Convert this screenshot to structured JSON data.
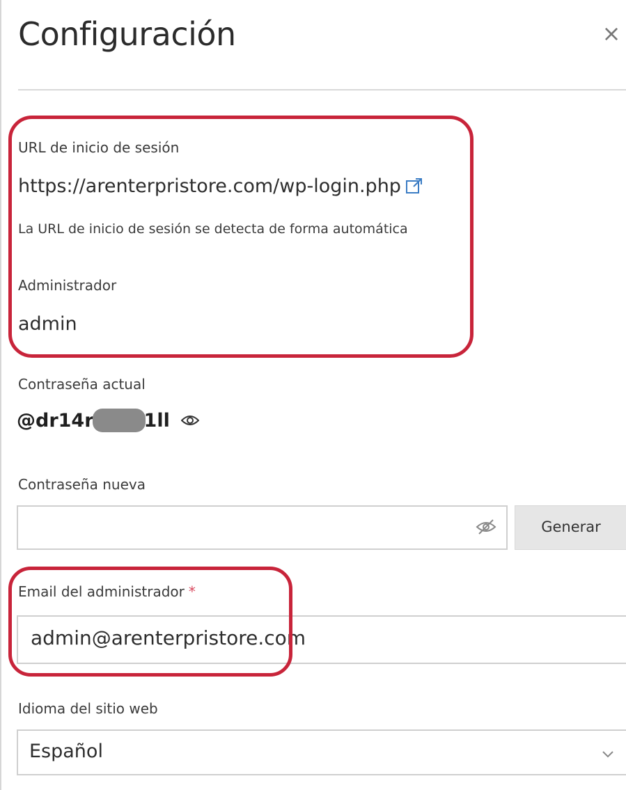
{
  "dialog": {
    "title": "Configuración",
    "close_label": "×"
  },
  "login_url": {
    "label": "URL de inicio de sesión",
    "value": "https://arenterpristore.com/wp-login.php",
    "hint": "La URL de inicio de sesión se detecta de forma automática",
    "icon": "external-link-icon"
  },
  "administrator": {
    "label": "Administrador",
    "value": "admin"
  },
  "current_password": {
    "label": "Contraseña actual",
    "visible_start": "@dr14r",
    "visible_end": "1ll",
    "icon": "eye-icon"
  },
  "new_password": {
    "label": "Contraseña nueva",
    "value": "",
    "icon": "eye-slash-icon",
    "generate_label": "Generar"
  },
  "admin_email": {
    "label": "Email del administrador",
    "required_marker": "*",
    "value": "admin@arenterpristore.com"
  },
  "site_language": {
    "label": "Idioma del sitio web",
    "selected": "Español",
    "icon": "chevron-down-icon"
  },
  "colors": {
    "highlight": "#c8243a",
    "link": "#3a7cc4",
    "required": "#d9485e"
  }
}
